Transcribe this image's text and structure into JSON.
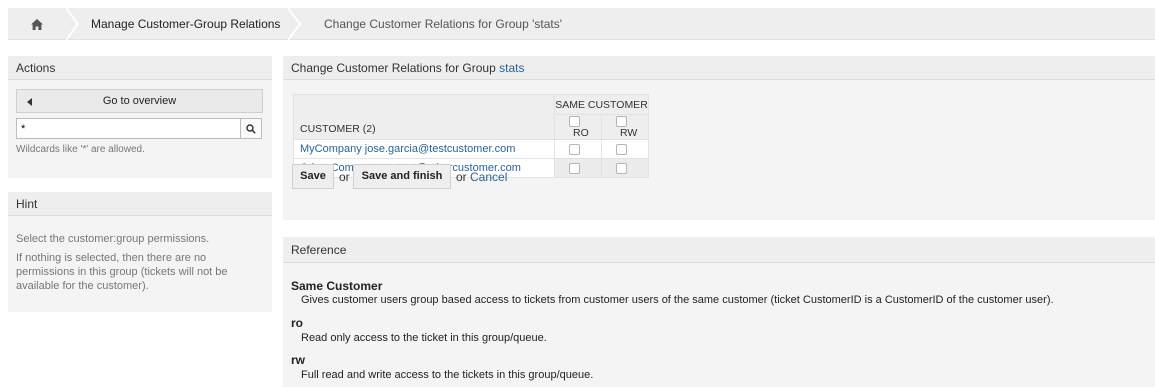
{
  "breadcrumb": {
    "home_icon": "home-icon",
    "items": [
      {
        "label": "Manage Customer-Group Relations"
      },
      {
        "label": "Change Customer Relations for Group 'stats'"
      }
    ]
  },
  "actions": {
    "title": "Actions",
    "overview_label": "Go to overview",
    "search_value": "*",
    "search_icon": "search-icon",
    "wildcard_hint": "Wildcards like '*' are allowed."
  },
  "hint": {
    "title": "Hint",
    "lines": [
      "Select the customer:group permissions.",
      "If nothing is selected, then there are no permissions in this group (tickets will not be available for the customer)."
    ]
  },
  "main": {
    "title_prefix": "Change Customer Relations for Group",
    "group_name": "stats",
    "table": {
      "group_header": "SAME CUSTOMER",
      "customer_header": "CUSTOMER (2)",
      "ro_label": "RO",
      "rw_label": "RW",
      "rows": [
        {
          "customer": "MyCompany jose.garcia@testcustomer.com",
          "ro": false,
          "rw": false
        },
        {
          "customer": "Other Company contact@othercustomer.com",
          "ro": false,
          "rw": false
        }
      ]
    },
    "save_label": "Save",
    "or_text": "or",
    "save_finish_label": "Save and finish",
    "or_text2": "or",
    "cancel_label": "Cancel"
  },
  "reference": {
    "title": "Reference",
    "entries": [
      {
        "term": "Same Customer",
        "desc": "Gives customer users group based access to tickets from customer users of the same customer (ticket CustomerID is a CustomerID of the customer user)."
      },
      {
        "term": "ro",
        "desc": "Read only access to the ticket in this group/queue."
      },
      {
        "term": "rw",
        "desc": "Full read and write access to the tickets in this group/queue."
      }
    ]
  },
  "colors": {
    "link": "#2a6496",
    "panel_bg": "#f4f4f4",
    "header_bg": "#eeeeee"
  }
}
